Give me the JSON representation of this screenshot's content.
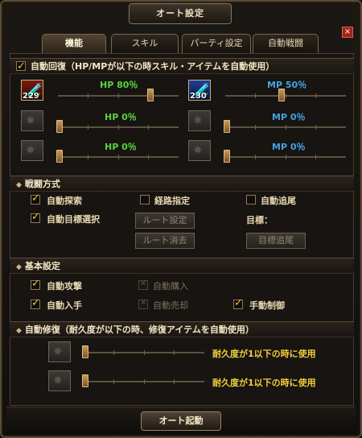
{
  "window": {
    "title": "オート設定",
    "close": "×"
  },
  "tabs": [
    {
      "label": "機能",
      "active": true
    },
    {
      "label": "スキル",
      "active": false
    },
    {
      "label": "パーティ設定",
      "active": false
    },
    {
      "label": "自動戦闘",
      "active": false
    }
  ],
  "auto_recovery": {
    "header": "自動回復（HP/MPが以下の時スキル・アイテムを自動使用）",
    "rows": [
      {
        "hp_slot_count": "229",
        "hp_label": "HP 80％",
        "hp_level": 0.8,
        "mp_slot_count": "230",
        "mp_label": "MP 50％",
        "mp_level": 0.5
      },
      {
        "hp_slot_count": "",
        "hp_label": "HP 0％",
        "hp_level": 0,
        "mp_slot_count": "",
        "mp_label": "MP 0％",
        "mp_level": 0
      },
      {
        "hp_slot_count": "",
        "hp_label": "HP 0％",
        "hp_level": 0,
        "mp_slot_count": "",
        "mp_label": "MP 0％",
        "mp_level": 0
      }
    ]
  },
  "combat": {
    "header": "戦闘方式",
    "auto_search": "自動探索",
    "route_specify": "経路指定",
    "auto_follow": "自動追尾",
    "auto_target": "自動目標選択",
    "route_settings": "ルート設定",
    "target_label": "目標：",
    "route_clear": "ルート消去",
    "target_follow": "目標追尾"
  },
  "basic": {
    "header": "基本設定",
    "auto_attack": "自動攻撃",
    "auto_purchase": "自動購入",
    "auto_pickup": "自動入手",
    "auto_sell": "自動売却",
    "manual_control": "手動制御"
  },
  "repair": {
    "header": "自動修復（耐久度が以下の時、修復アイテムを自動使用）",
    "row1": "耐久度が1以下の時に使用",
    "row2": "耐久度が1以下の時に使用"
  },
  "start_button": "オート起動"
}
